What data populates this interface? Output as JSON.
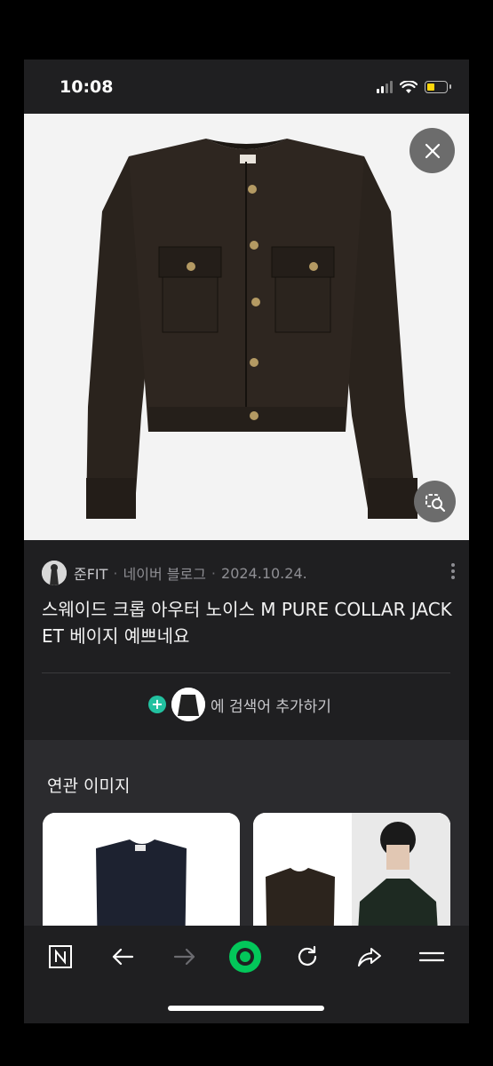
{
  "status_bar": {
    "time": "10:08"
  },
  "result": {
    "author": "준FIT",
    "source": "네이버 블로그",
    "separator": "·",
    "date": "2024.10.24.",
    "title": "스웨이드 크롭 아우터 노이스 M PURE COLLAR JACKET 베이지 예쁘네요"
  },
  "add_search": {
    "plus": "+",
    "label": "에 검색어 추가하기"
  },
  "related": {
    "title": "연관 이미지"
  },
  "icons": {
    "close": "close-icon",
    "lens": "image-search-icon",
    "more": "more-vertical-icon",
    "nav": [
      "naver-n-icon",
      "back-arrow-icon",
      "forward-arrow-icon",
      "green-dot-icon",
      "refresh-icon",
      "share-icon",
      "menu-icon"
    ]
  },
  "colors": {
    "accent_green": "#03c75a",
    "teal": "#22c1a0",
    "battery": "#ffd60a"
  }
}
